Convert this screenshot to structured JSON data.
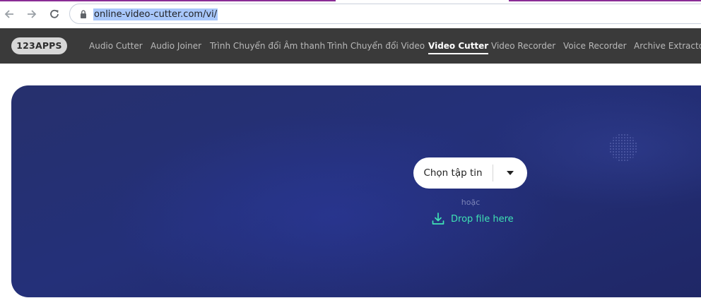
{
  "browser": {
    "url": "online-video-cutter.com/vi/",
    "icons": [
      "back-icon",
      "forward-icon",
      "reload-icon",
      "lock-icon"
    ]
  },
  "site": {
    "logo": "123APPS",
    "nav": [
      {
        "label": "Audio Cutter",
        "active": false
      },
      {
        "label": "Audio Joiner",
        "active": false
      },
      {
        "label": "Trình Chuyển đổi Âm thanh",
        "active": false
      },
      {
        "label": "Trình Chuyển đổi Video",
        "active": false
      },
      {
        "label": "Video Cutter",
        "active": true
      },
      {
        "label": "Video Recorder",
        "active": false
      },
      {
        "label": "Voice Recorder",
        "active": false
      },
      {
        "label": "Archive Extractor",
        "active": false
      }
    ]
  },
  "upload": {
    "choose_label": "Chọn tập tin",
    "or_label": "hoặc",
    "drop_label": "Drop file here"
  },
  "colors": {
    "nav_bg": "#3a3a3a",
    "hero_bg": "#243079",
    "drop_accent": "#3fe3b4",
    "url_highlight": "#a8c7fa"
  }
}
